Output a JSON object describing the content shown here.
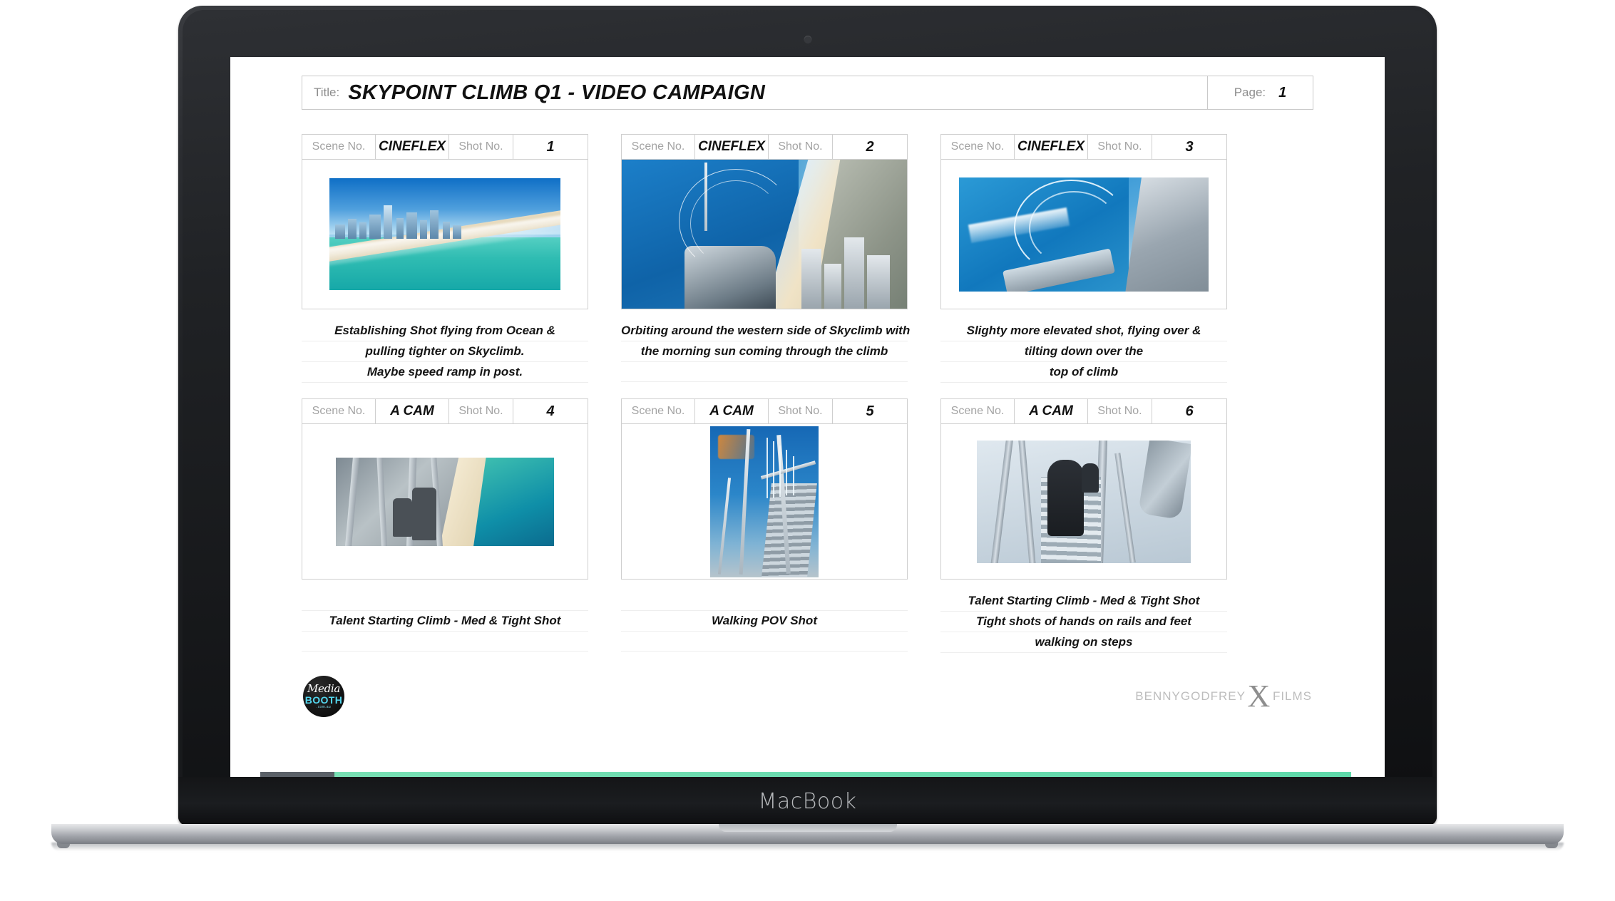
{
  "device": {
    "brand_label": "MacBook"
  },
  "document": {
    "title_label": "Title:",
    "title_value": "SKYPOINT CLIMB Q1 - VIDEO CAMPAIGN",
    "page_label": "Page:",
    "page_value": "1",
    "scene_label": "Scene No.",
    "shot_label": "Shot No.",
    "cells": [
      {
        "camera": "CINEFLEX",
        "shot_no": "1",
        "image_name": "aerial-beach-skyline-photo",
        "caption_lines": [
          "Establishing Shot flying from Ocean &",
          "pulling tighter on Skyclimb.",
          "Maybe speed ramp in post."
        ]
      },
      {
        "camera": "CINEFLEX",
        "shot_no": "2",
        "image_name": "skypoint-tower-coast-photo",
        "caption_lines": [
          "Orbiting around the western side of Skyclimb with",
          "the morning sun coming through the climb",
          ""
        ]
      },
      {
        "camera": "CINEFLEX",
        "shot_no": "3",
        "image_name": "elevated-tilt-over-climb-photo",
        "caption_lines": [
          "Slighty more elevated shot, flying over &",
          "tilting down over the",
          "top of climb"
        ]
      },
      {
        "camera": "A CAM",
        "shot_no": "4",
        "image_name": "climbers-panorama-photo",
        "caption_lines": [
          "",
          "Talent Starting Climb -  Med & Tight Shot",
          ""
        ]
      },
      {
        "camera": "A CAM",
        "shot_no": "5",
        "image_name": "staircase-sky-portrait-photo",
        "caption_lines": [
          "",
          "Walking POV Shot",
          ""
        ]
      },
      {
        "camera": "A CAM",
        "shot_no": "6",
        "image_name": "pov-stairs-climber-photo",
        "caption_lines": [
          "Talent Starting Climb -  Med & Tight Shot",
          "Tight shots of hands on rails and feet",
          "walking on steps"
        ]
      }
    ],
    "footer": {
      "media_booth": {
        "line1": "Media",
        "line2": "BOOTH",
        "line3": ".com.au"
      },
      "benny_godfrey": {
        "left": "BENNYGODFREY",
        "mark": "X",
        "right": "FILMS"
      }
    }
  },
  "colors": {
    "accent_green": "#6ddcb0",
    "label_gray": "#a3a3a3",
    "border_gray": "#cfcfcf",
    "logo_cyan": "#53d7ef"
  }
}
